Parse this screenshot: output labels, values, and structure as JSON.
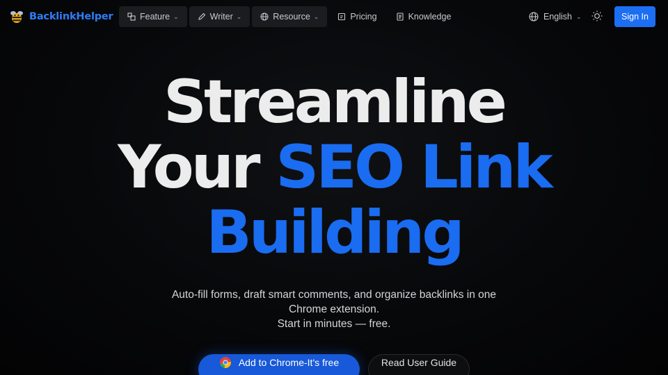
{
  "brand": {
    "name": "BacklinkHelper"
  },
  "nav": {
    "items": [
      {
        "label": "Feature",
        "icon": "shapes-icon",
        "dropdown": true
      },
      {
        "label": "Writer",
        "icon": "pen-icon",
        "dropdown": true
      },
      {
        "label": "Resource",
        "icon": "globe-icon",
        "dropdown": true
      },
      {
        "label": "Pricing",
        "icon": "tag-icon",
        "dropdown": false
      },
      {
        "label": "Knowledge",
        "icon": "book-icon",
        "dropdown": false
      }
    ],
    "language": "English",
    "signin_label": "Sign In"
  },
  "hero": {
    "line1": "Streamline",
    "line2_plain": "Your ",
    "line2_accent": "SEO Link",
    "line3_accent": "Building",
    "subtitle_line1": "Auto-fill forms, draft smart comments, and organize backlinks in one",
    "subtitle_line2": "Chrome extension.",
    "subtitle_line3": "Start in minutes — free.",
    "cta_primary": "Add to Chrome-It's free",
    "cta_secondary": "Read User Guide"
  },
  "colors": {
    "accent": "#1a6cf1",
    "background": "#07080a",
    "nav_box": "#1b1c1f"
  }
}
